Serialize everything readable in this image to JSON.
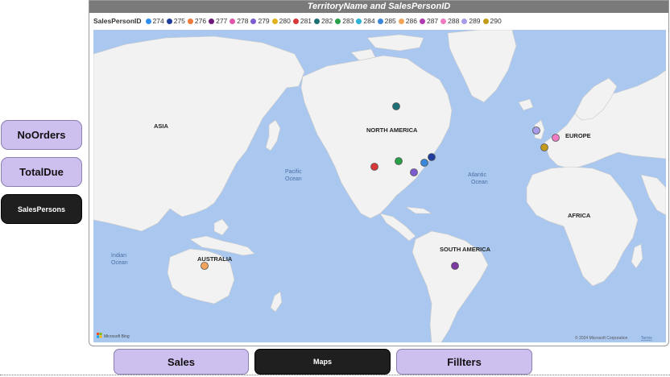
{
  "nav": {
    "no_orders": "NoOrders",
    "total_due": "TotalDue",
    "sales_persons": "SalesPersons"
  },
  "bottom_nav": {
    "sales": "Sales",
    "maps": "Maps",
    "filters": "Fillters"
  },
  "visual": {
    "title": "TerritoryName and SalesPersonID",
    "legend_title": "SalesPersonID",
    "legend": [
      {
        "id": "274",
        "color": "#2e8ef0"
      },
      {
        "id": "275",
        "color": "#1f3b9e"
      },
      {
        "id": "276",
        "color": "#ee7a3a"
      },
      {
        "id": "277",
        "color": "#6b1a78"
      },
      {
        "id": "278",
        "color": "#e255a8"
      },
      {
        "id": "279",
        "color": "#7d5bd0"
      },
      {
        "id": "280",
        "color": "#e3b21e"
      },
      {
        "id": "281",
        "color": "#d9383a"
      },
      {
        "id": "282",
        "color": "#1c6f74"
      },
      {
        "id": "283",
        "color": "#27a048"
      },
      {
        "id": "284",
        "color": "#2db3d6"
      },
      {
        "id": "285",
        "color": "#3a86d8"
      },
      {
        "id": "286",
        "color": "#f2a55a"
      },
      {
        "id": "287",
        "color": "#b03bb0"
      },
      {
        "id": "288",
        "color": "#f07bc3"
      },
      {
        "id": "289",
        "color": "#a99be8"
      },
      {
        "id": "290",
        "color": "#c49a1a"
      }
    ]
  },
  "map": {
    "regions": {
      "asia": "ASIA",
      "north_america": "NORTH AMERICA",
      "europe": "EUROPE",
      "africa": "AFRICA",
      "south_america": "SOUTH AMERICA",
      "australia": "AUSTRALIA"
    },
    "oceans": {
      "pacific_1": "Pacific",
      "pacific_2": "Ocean",
      "atlantic_1": "Atlantic",
      "atlantic_2": "Ocean",
      "indian_1": "Indian",
      "indian_2": "Ocean"
    },
    "bing_logo": "Microsoft Bing",
    "copyright": "© 2024 Microsoft Corporation",
    "terms": "Terms"
  }
}
